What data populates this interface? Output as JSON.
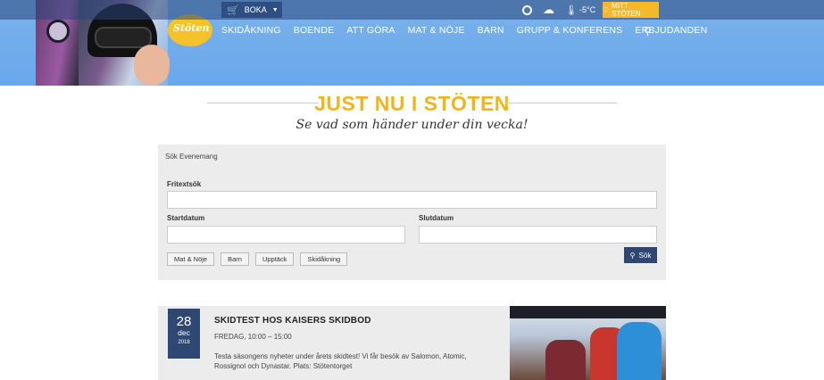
{
  "topbar": {
    "boka_label": "BOKA",
    "temperature": "-5°C",
    "mitt_label": "MITT STÖTEN"
  },
  "logo": {
    "text": "Stöten"
  },
  "nav": {
    "items": [
      "SKIDÅKNING",
      "BOENDE",
      "ATT GÖRA",
      "MAT & NÖJE",
      "BARN",
      "GRUPP & KONFERENS",
      "ERBJUDANDEN"
    ]
  },
  "heading": {
    "title": "JUST NU I STÖTEN",
    "subtitle": "Se vad som händer under din vecka!"
  },
  "search": {
    "header": "Sök Evenemang",
    "fritext_label": "Fritextsök",
    "startdatum_label": "Startdatum",
    "slutdatum_label": "Slutdatum",
    "fritext_value": "",
    "startdatum_value": "",
    "slutdatum_value": "",
    "chips": [
      "Mat & Nöje",
      "Barn",
      "Upptäck",
      "Skidåkning"
    ],
    "submit_label": "Sök"
  },
  "event": {
    "day": "28",
    "month": "dec",
    "year": "2018",
    "title": "SKIDTEST HOS KAISERS SKIDBOD",
    "time": "FREDAG, 10:00 – 15:00",
    "description": "Testa säsongens nyheter under årets skidtest! Vi får besök av Salomon, Atomic, Rossignol och Dynastar. Plats: Stötentorget"
  },
  "colors": {
    "header_blue": "#6aa8ec",
    "accent_yellow": "#f2b418",
    "navy": "#2f4873"
  }
}
